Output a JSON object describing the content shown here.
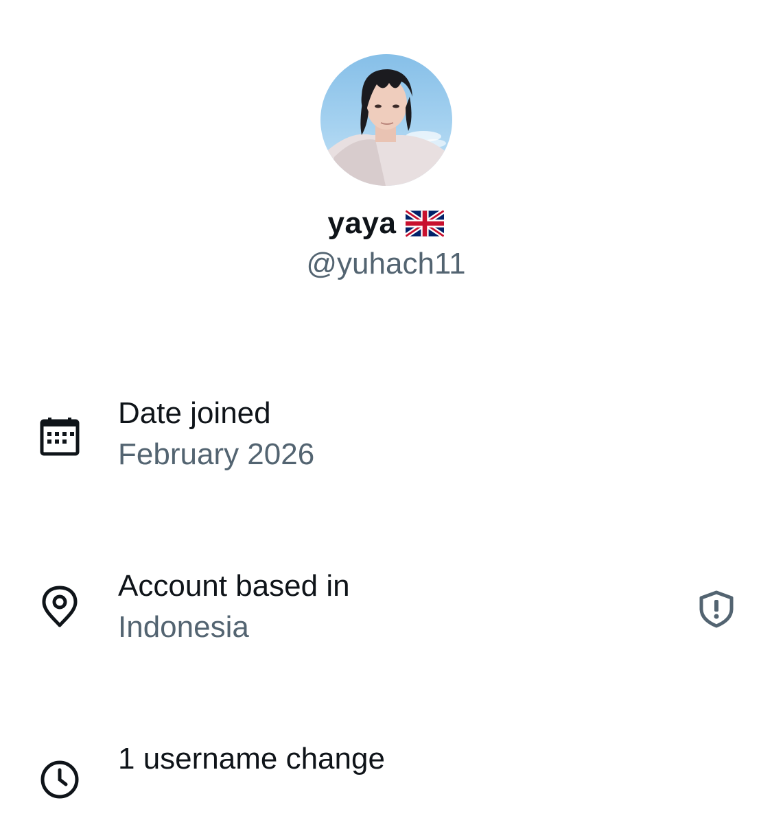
{
  "profile": {
    "display_name": "yaya",
    "flag_icon": "uk-flag-icon",
    "handle": "@yuhach11",
    "avatar": "avatar-photo"
  },
  "details": [
    {
      "icon": "calendar-icon",
      "label": "Date joined",
      "value": "February 2026"
    },
    {
      "icon": "location-pin-icon",
      "label": "Account based in",
      "value": "Indonesia",
      "trailing_icon": "shield-alert-icon"
    },
    {
      "icon": "history-icon",
      "label": "1 username change",
      "value": ""
    }
  ],
  "colors": {
    "primary_text": "#0f1419",
    "secondary_text": "#536471",
    "background": "#ffffff"
  }
}
